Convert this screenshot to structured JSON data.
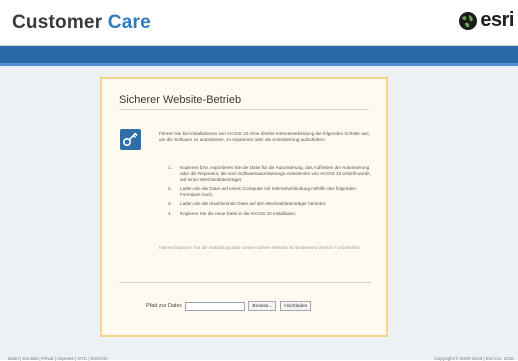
{
  "header": {
    "brand_word1": "Customer",
    "brand_word2": "Care",
    "logo_text": "esri"
  },
  "panel": {
    "title": "Sicherer Website-Betrieb",
    "intro": "Führen Sie bei Installationen von ArcGIS 10 ohne direkte Internetverbindung die folgenden Schritte aus, um die Software zu autorisieren, zu reparieren oder die Autorisierung aufzuheben:",
    "steps": [
      {
        "num": "1.",
        "text": "Kopieren bzw. exportieren Sie die Datei für die Autorisierung, das Aufheben der Autorisierung oder die Reparatur, die vom Softwareautorisierungs-Assistenten von ArcGIS 10 erstellt wurde, auf einen Wechseldatenträger."
      },
      {
        "num": "2.",
        "text": "Laden Sie die Datei auf einem Computer mit Internetverbindung mithilfe des folgenden Formulars hoch."
      },
      {
        "num": "3.",
        "text": "Laden Sie die resultierende Datei auf den Wechseldatenträger herunter."
      },
      {
        "num": "4.",
        "text": "Kopieren Sie die neue Datei in die ArcGIS 10 Installation."
      }
    ],
    "note": "Internet Explorer: Für die Abwicklung über unsere sichere Website ist mindestens Version 7 erforderlich.",
    "form": {
      "label": "Pfad zur Datei:",
      "file_value": "",
      "browse_label": "Browse...",
      "upload_label": "Hochladen"
    }
  },
  "footer": {
    "left": "Datei | Kontakt | Privat | Impress | GTC | DSGVO",
    "right": "Copyright © ESRI 2010 | Esri Inc. 2010"
  },
  "colors": {
    "bar": "#2768a8",
    "brand_accent": "#2f7cc1",
    "panel_border": "#f2d58a"
  }
}
